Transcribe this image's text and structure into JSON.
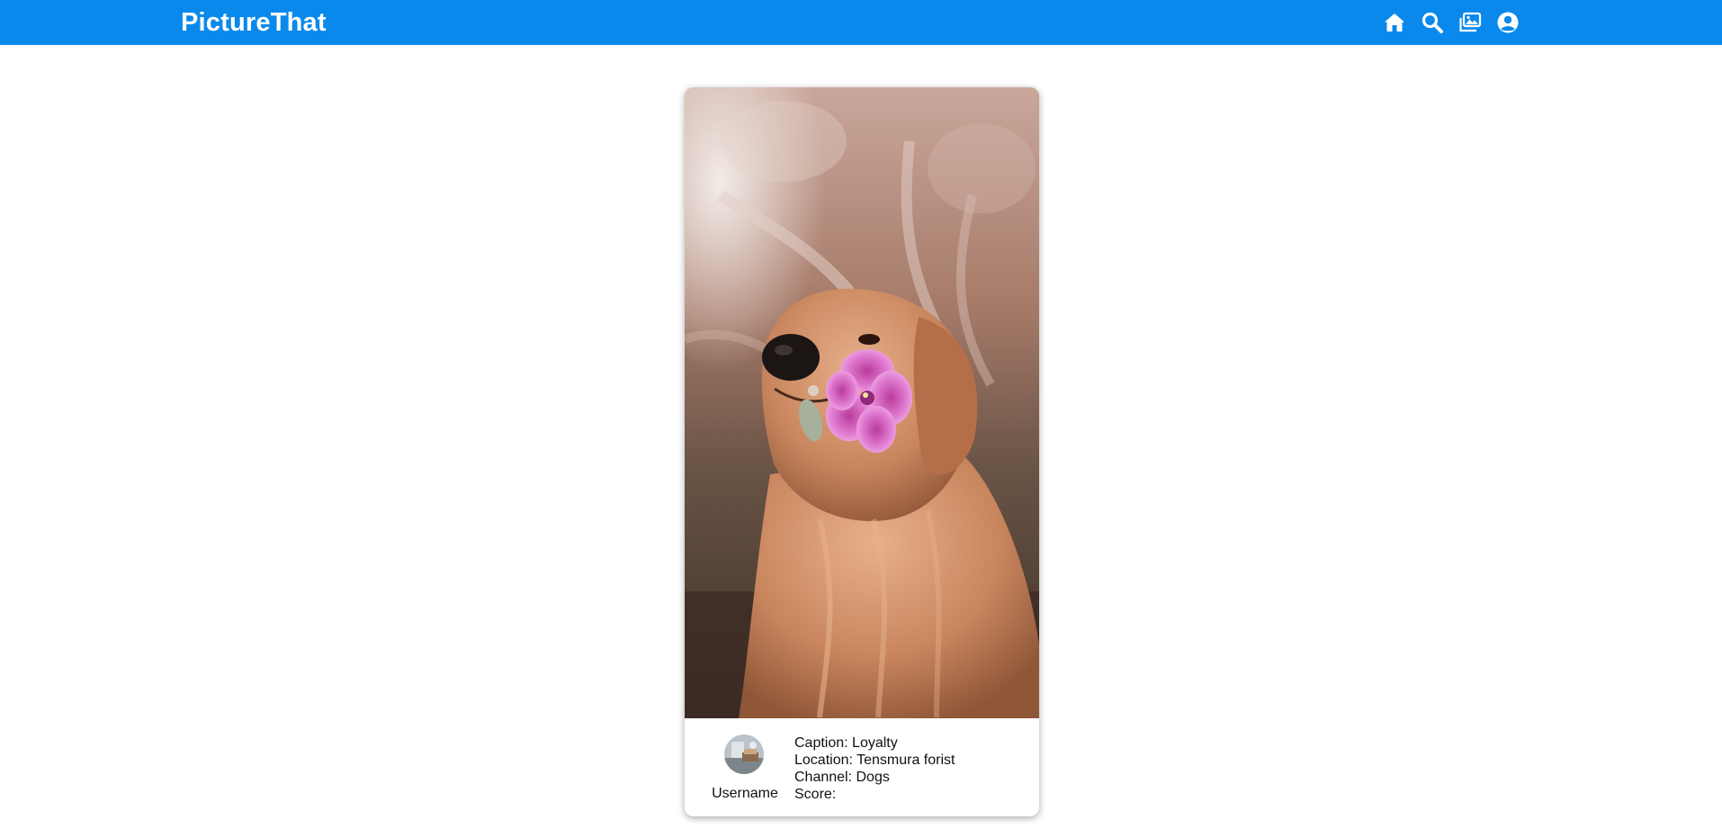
{
  "header": {
    "brand": "PictureThat",
    "color": "#0a89ec",
    "nav": [
      {
        "icon": "home-icon"
      },
      {
        "icon": "search-icon"
      },
      {
        "icon": "gallery-icon"
      },
      {
        "icon": "account-icon"
      }
    ]
  },
  "post": {
    "image": "golden-retriever-holding-pink-flower",
    "username": "Username",
    "caption_label": "Caption: Loyalty",
    "location_label": "Location: Tensmura forist",
    "channel_label": "Channel: Dogs",
    "score_label": "Score:"
  }
}
